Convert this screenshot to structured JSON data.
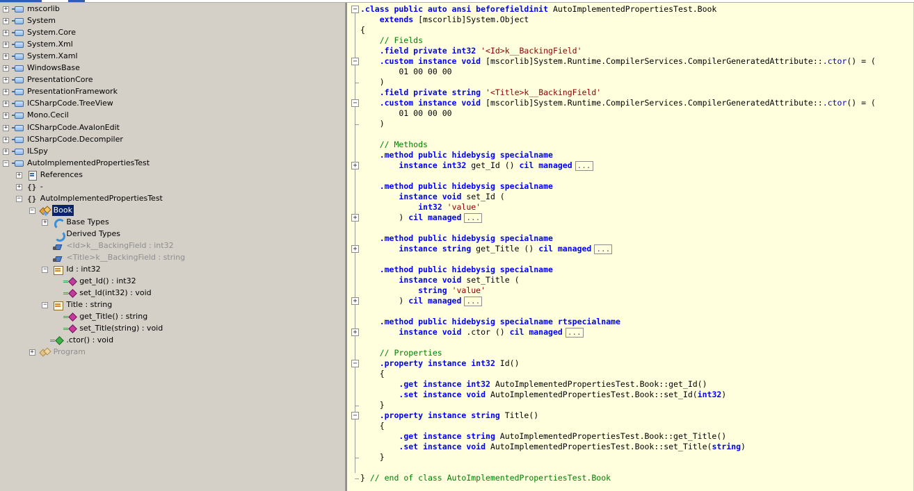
{
  "tree": {
    "items": [
      {
        "label": "mscorlib",
        "icon": "assembly-icon",
        "expander": "+",
        "indent": 0
      },
      {
        "label": "System",
        "icon": "assembly-icon",
        "expander": "+",
        "indent": 0
      },
      {
        "label": "System.Core",
        "icon": "assembly-icon",
        "expander": "+",
        "indent": 0
      },
      {
        "label": "System.Xml",
        "icon": "assembly-icon",
        "expander": "+",
        "indent": 0
      },
      {
        "label": "System.Xaml",
        "icon": "assembly-icon",
        "expander": "+",
        "indent": 0
      },
      {
        "label": "WindowsBase",
        "icon": "assembly-icon",
        "expander": "+",
        "indent": 0
      },
      {
        "label": "PresentationCore",
        "icon": "assembly-icon",
        "expander": "+",
        "indent": 0
      },
      {
        "label": "PresentationFramework",
        "icon": "assembly-icon",
        "expander": "+",
        "indent": 0
      },
      {
        "label": "ICSharpCode.TreeView",
        "icon": "assembly-icon",
        "expander": "+",
        "indent": 0
      },
      {
        "label": "Mono.Cecil",
        "icon": "assembly-icon",
        "expander": "+",
        "indent": 0
      },
      {
        "label": "ICSharpCode.AvalonEdit",
        "icon": "assembly-icon",
        "expander": "+",
        "indent": 0
      },
      {
        "label": "ICSharpCode.Decompiler",
        "icon": "assembly-icon",
        "expander": "+",
        "indent": 0
      },
      {
        "label": "ILSpy",
        "icon": "assembly-icon",
        "expander": "+",
        "indent": 0
      },
      {
        "label": "AutoImplementedPropertiesTest",
        "icon": "assembly-icon",
        "expander": "-",
        "indent": 0
      },
      {
        "label": "References",
        "icon": "references-icon",
        "expander": "+",
        "indent": 1
      },
      {
        "label": "-",
        "icon": "namespace-icon",
        "expander": "+",
        "indent": 1
      },
      {
        "label": "AutoImplementedPropertiesTest",
        "icon": "namespace-icon",
        "expander": "-",
        "indent": 1
      },
      {
        "label": "Book",
        "icon": "class-icon",
        "expander": "-",
        "indent": 2,
        "selected": true
      },
      {
        "label": "Base Types",
        "icon": "base-types-icon",
        "expander": "+",
        "indent": 3
      },
      {
        "label": "Derived Types",
        "icon": "derived-types-icon",
        "expander": "",
        "indent": 3
      },
      {
        "label": "<Id>k__BackingField : int32",
        "icon": "private-field-icon",
        "expander": "",
        "indent": 3,
        "grey": true
      },
      {
        "label": "<Title>k__BackingField : string",
        "icon": "private-field-icon",
        "expander": "",
        "indent": 3,
        "grey": true
      },
      {
        "label": "Id : int32",
        "icon": "property-icon",
        "expander": "-",
        "indent": 3
      },
      {
        "label": "get_Id() : int32",
        "icon": "method-icon",
        "expander": "",
        "indent": 4
      },
      {
        "label": "set_Id(int32) : void",
        "icon": "method-icon",
        "expander": "",
        "indent": 4
      },
      {
        "label": "Title : string",
        "icon": "property-icon",
        "expander": "-",
        "indent": 3
      },
      {
        "label": "get_Title() : string",
        "icon": "method-icon",
        "expander": "",
        "indent": 4
      },
      {
        "label": "set_Title(string) : void",
        "icon": "method-icon",
        "expander": "",
        "indent": 4
      },
      {
        "label": ".ctor() : void",
        "icon": "constructor-icon",
        "expander": "",
        "indent": 3
      },
      {
        "label": "Program",
        "icon": "program-class-icon",
        "expander": "+",
        "indent": 2,
        "grey": true
      }
    ]
  },
  "code": {
    "collapsed_marker": "...",
    "lines": [
      {
        "fold": "-",
        "tokens": [
          [
            "kw",
            ".class public auto ansi beforefieldinit "
          ],
          [
            "plain",
            "AutoImplementedPropertiesTest.Book"
          ]
        ]
      },
      {
        "tokens": [
          [
            "plain",
            "    "
          ],
          [
            "kw",
            "extends "
          ],
          [
            "plain",
            "[mscorlib]System.Object"
          ]
        ]
      },
      {
        "tokens": [
          [
            "plain",
            "{"
          ]
        ]
      },
      {
        "tokens": [
          [
            "com",
            "    // Fields"
          ]
        ]
      },
      {
        "tokens": [
          [
            "plain",
            "    "
          ],
          [
            "kw",
            ".field private int32 "
          ],
          [
            "str",
            "'<Id>k__BackingField'"
          ]
        ]
      },
      {
        "fold": "-",
        "tokens": [
          [
            "plain",
            "    "
          ],
          [
            "kw",
            ".custom instance void "
          ],
          [
            "plain",
            "[mscorlib]System.Runtime.CompilerServices.CompilerGeneratedAttribute::"
          ],
          [
            "type",
            ".ctor"
          ],
          [
            "plain",
            "() = ("
          ]
        ]
      },
      {
        "tokens": [
          [
            "plain",
            "        01 00 00 00"
          ]
        ]
      },
      {
        "tokens": [
          [
            "plain",
            "    )"
          ]
        ]
      },
      {
        "tokens": [
          [
            "plain",
            "    "
          ],
          [
            "kw",
            ".field private string "
          ],
          [
            "str",
            "'<Title>k__BackingField'"
          ]
        ]
      },
      {
        "fold": "-",
        "tokens": [
          [
            "plain",
            "    "
          ],
          [
            "kw",
            ".custom instance void "
          ],
          [
            "plain",
            "[mscorlib]System.Runtime.CompilerServices.CompilerGeneratedAttribute::"
          ],
          [
            "type",
            ".ctor"
          ],
          [
            "plain",
            "() = ("
          ]
        ]
      },
      {
        "tokens": [
          [
            "plain",
            "        01 00 00 00"
          ]
        ]
      },
      {
        "tokens": [
          [
            "plain",
            "    )"
          ]
        ]
      },
      {
        "tokens": [
          [
            "plain",
            ""
          ]
        ]
      },
      {
        "tokens": [
          [
            "com",
            "    // Methods"
          ]
        ]
      },
      {
        "tokens": [
          [
            "plain",
            "    "
          ],
          [
            "kw",
            ".method public hidebysig specialname"
          ]
        ]
      },
      {
        "fold": "+",
        "collapsed": true,
        "tokens": [
          [
            "plain",
            "        "
          ],
          [
            "kw",
            "instance int32 "
          ],
          [
            "plain",
            "get_Id () "
          ],
          [
            "kw",
            "cil managed"
          ]
        ]
      },
      {
        "tokens": [
          [
            "plain",
            ""
          ]
        ]
      },
      {
        "tokens": [
          [
            "plain",
            "    "
          ],
          [
            "kw",
            ".method public hidebysig specialname"
          ]
        ]
      },
      {
        "tokens": [
          [
            "plain",
            "        "
          ],
          [
            "kw",
            "instance void "
          ],
          [
            "plain",
            "set_Id ("
          ]
        ]
      },
      {
        "tokens": [
          [
            "plain",
            "            "
          ],
          [
            "kw",
            "int32 "
          ],
          [
            "str",
            "'value'"
          ]
        ]
      },
      {
        "fold": "+",
        "collapsed": true,
        "tokens": [
          [
            "plain",
            "        ) "
          ],
          [
            "kw",
            "cil managed"
          ]
        ]
      },
      {
        "tokens": [
          [
            "plain",
            ""
          ]
        ]
      },
      {
        "tokens": [
          [
            "plain",
            "    "
          ],
          [
            "kw",
            ".method public hidebysig specialname"
          ]
        ]
      },
      {
        "fold": "+",
        "collapsed": true,
        "tokens": [
          [
            "plain",
            "        "
          ],
          [
            "kw",
            "instance string "
          ],
          [
            "plain",
            "get_Title () "
          ],
          [
            "kw",
            "cil managed"
          ]
        ]
      },
      {
        "tokens": [
          [
            "plain",
            ""
          ]
        ]
      },
      {
        "tokens": [
          [
            "plain",
            "    "
          ],
          [
            "kw",
            ".method public hidebysig specialname"
          ]
        ]
      },
      {
        "tokens": [
          [
            "plain",
            "        "
          ],
          [
            "kw",
            "instance void "
          ],
          [
            "plain",
            "set_Title ("
          ]
        ]
      },
      {
        "tokens": [
          [
            "plain",
            "            "
          ],
          [
            "kw",
            "string "
          ],
          [
            "str",
            "'value'"
          ]
        ]
      },
      {
        "fold": "+",
        "collapsed": true,
        "tokens": [
          [
            "plain",
            "        ) "
          ],
          [
            "kw",
            "cil managed"
          ]
        ]
      },
      {
        "tokens": [
          [
            "plain",
            ""
          ]
        ]
      },
      {
        "tokens": [
          [
            "plain",
            "    "
          ],
          [
            "kw",
            ".method public hidebysig specialname rtspecialname"
          ]
        ]
      },
      {
        "fold": "+",
        "collapsed": true,
        "tokens": [
          [
            "plain",
            "        "
          ],
          [
            "kw",
            "instance void "
          ],
          [
            "plain",
            ".ctor () "
          ],
          [
            "kw",
            "cil managed"
          ]
        ]
      },
      {
        "tokens": [
          [
            "plain",
            ""
          ]
        ]
      },
      {
        "tokens": [
          [
            "com",
            "    // Properties"
          ]
        ]
      },
      {
        "fold": "-",
        "tokens": [
          [
            "plain",
            "    "
          ],
          [
            "kw",
            ".property instance int32 "
          ],
          [
            "plain",
            "Id()"
          ]
        ]
      },
      {
        "tokens": [
          [
            "plain",
            "    {"
          ]
        ]
      },
      {
        "tokens": [
          [
            "plain",
            "        "
          ],
          [
            "kw",
            ".get instance int32 "
          ],
          [
            "plain",
            "AutoImplementedPropertiesTest.Book::get_Id()"
          ]
        ]
      },
      {
        "tokens": [
          [
            "plain",
            "        "
          ],
          [
            "kw",
            ".set instance void "
          ],
          [
            "plain",
            "AutoImplementedPropertiesTest.Book::set_Id("
          ],
          [
            "kw",
            "int32"
          ],
          [
            "plain",
            ")"
          ]
        ]
      },
      {
        "tokens": [
          [
            "plain",
            "    }"
          ]
        ]
      },
      {
        "fold": "-",
        "tokens": [
          [
            "plain",
            "    "
          ],
          [
            "kw",
            ".property instance string "
          ],
          [
            "plain",
            "Title()"
          ]
        ]
      },
      {
        "tokens": [
          [
            "plain",
            "    {"
          ]
        ]
      },
      {
        "tokens": [
          [
            "plain",
            "        "
          ],
          [
            "kw",
            ".get instance string "
          ],
          [
            "plain",
            "AutoImplementedPropertiesTest.Book::get_Title()"
          ]
        ]
      },
      {
        "tokens": [
          [
            "plain",
            "        "
          ],
          [
            "kw",
            ".set instance void "
          ],
          [
            "plain",
            "AutoImplementedPropertiesTest.Book::set_Title("
          ],
          [
            "kw",
            "string"
          ],
          [
            "plain",
            ")"
          ]
        ]
      },
      {
        "tokens": [
          [
            "plain",
            "    }"
          ]
        ]
      },
      {
        "tokens": [
          [
            "plain",
            ""
          ]
        ]
      },
      {
        "tokens": [
          [
            "plain",
            "} "
          ],
          [
            "com",
            "// end of class AutoImplementedPropertiesTest.Book"
          ]
        ]
      }
    ]
  },
  "colors": {
    "tree_bg": "#d4d0c8",
    "code_bg": "#ffffdd",
    "keyword": "#0000ff",
    "comment": "#008000",
    "string": "#8b0000",
    "selection": "#0a246a"
  }
}
